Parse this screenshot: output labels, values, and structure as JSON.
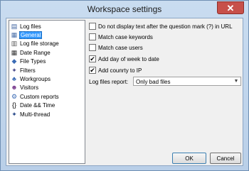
{
  "window": {
    "title": "Workspace settings",
    "close_glyph": "✕"
  },
  "tree": {
    "items": [
      {
        "label": "Log files",
        "icon": "log-files-icon",
        "glyph": "▤",
        "color": "#3a5f9e"
      },
      {
        "label": "General",
        "icon": "general-icon",
        "glyph": "▦",
        "color": "#4a6fa8",
        "selected": true
      },
      {
        "label": "Log file storage",
        "icon": "storage-icon",
        "glyph": "▥",
        "color": "#5a5a5a"
      },
      {
        "label": "Date Range",
        "icon": "calendar-icon",
        "glyph": "▦",
        "color": "#333333"
      },
      {
        "label": "File Types",
        "icon": "file-types-icon",
        "glyph": "◆",
        "color": "#3b6bb5"
      },
      {
        "label": "Filters",
        "icon": "filter-icon",
        "glyph": "✦",
        "color": "#4a4a8a"
      },
      {
        "label": "Workgroups",
        "icon": "workgroups-icon",
        "glyph": "♣",
        "color": "#3b6bb5"
      },
      {
        "label": "Visitors",
        "icon": "visitors-icon",
        "glyph": "☻",
        "color": "#7a3d8f"
      },
      {
        "label": "Custom reports",
        "icon": "custom-reports-icon",
        "glyph": "⚙",
        "color": "#3b6bb5"
      },
      {
        "label": "Date && Time",
        "icon": "braces-icon",
        "glyph": "{}",
        "color": "#000000"
      },
      {
        "label": "Multi-thread",
        "icon": "multithread-icon",
        "glyph": "✦",
        "color": "#2a4a8a"
      }
    ]
  },
  "settings": {
    "checkboxes": [
      {
        "label": "Do not display text after the question mark (?) in URL",
        "checked": false
      },
      {
        "label": "Match case keywords",
        "checked": false
      },
      {
        "label": "Match case users",
        "checked": false
      },
      {
        "label": "Add day of week to date",
        "checked": true
      },
      {
        "label": "Add counrty to IP",
        "checked": true
      }
    ],
    "report": {
      "label": "Log files report:",
      "value": "Only bad files"
    }
  },
  "buttons": {
    "ok": "OK",
    "cancel": "Cancel"
  },
  "check_glyph": "✔"
}
